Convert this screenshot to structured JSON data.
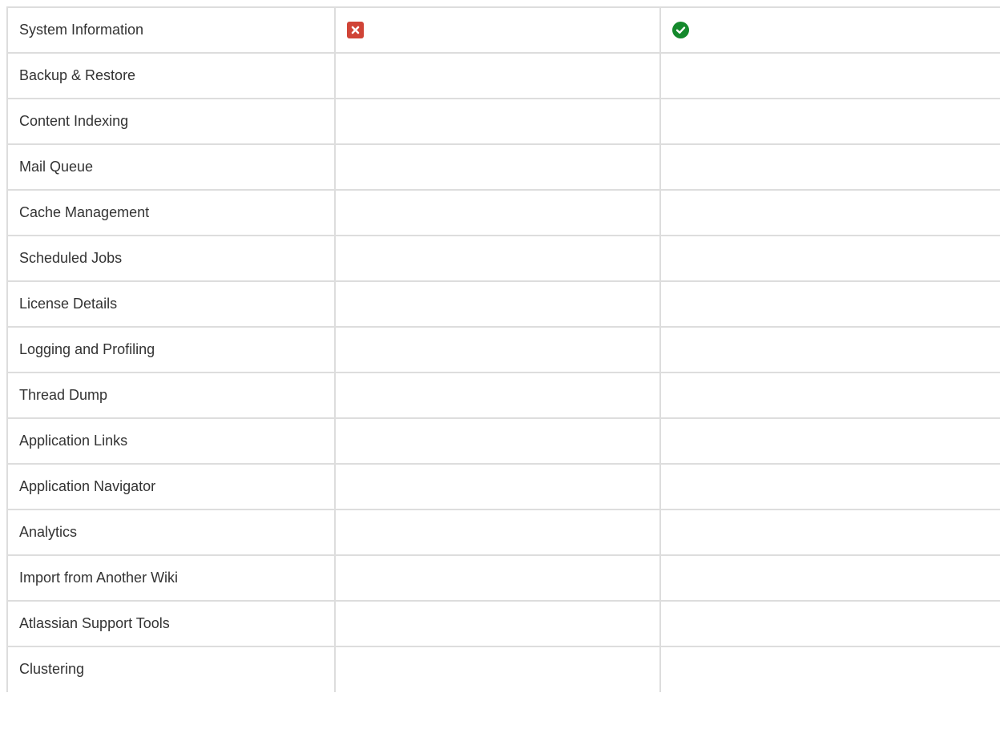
{
  "table": {
    "rows": [
      {
        "label": "System Information",
        "col2": "cross-icon",
        "col3": "check-icon"
      },
      {
        "label": "Backup & Restore"
      },
      {
        "label": "Content Indexing"
      },
      {
        "label": "Mail Queue"
      },
      {
        "label": "Cache Management"
      },
      {
        "label": "Scheduled Jobs"
      },
      {
        "label": "License Details"
      },
      {
        "label": "Logging and Profiling"
      },
      {
        "label": "Thread Dump"
      },
      {
        "label": "Application Links"
      },
      {
        "label": "Application Navigator"
      },
      {
        "label": "Analytics"
      },
      {
        "label": "Import from Another Wiki"
      },
      {
        "label": "Atlassian Support Tools"
      },
      {
        "label": "Clustering"
      }
    ]
  },
  "colors": {
    "cross": "#d04437",
    "check": "#14892c",
    "border": "#dddddd",
    "text": "#333333"
  }
}
